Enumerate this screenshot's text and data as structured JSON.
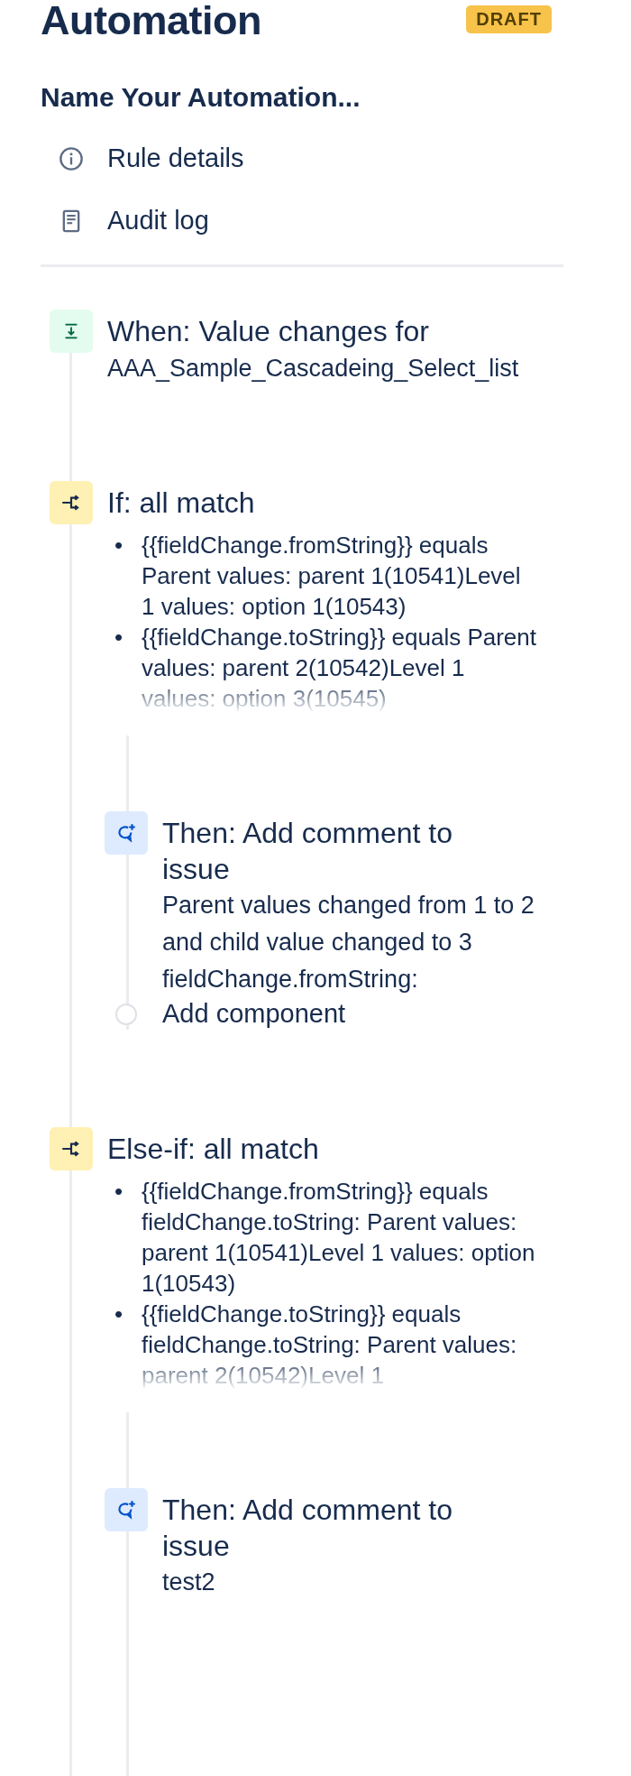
{
  "header": {
    "title": "Automation",
    "badge": "DRAFT"
  },
  "rule_name": "Name Your Automation...",
  "menu": [
    {
      "label": "Rule details"
    },
    {
      "label": "Audit log"
    }
  ],
  "steps": [
    {
      "kind": "trigger",
      "title": "When: Value changes for",
      "subtitle": "AAA_Sample_Cascadeing_Select_list"
    },
    {
      "kind": "condition",
      "title": "If: all match",
      "items": [
        {
          "marker": "•",
          "text": "{{fieldChange.fromString}} equals Parent values: parent 1(10541)Level 1 values: option 1(10543)"
        },
        {
          "marker": "•",
          "text": "{{fieldChange.toString}} equals Parent values: parent 2(10542)Level 1 values: option 3(10545)"
        }
      ],
      "children": [
        {
          "kind": "action",
          "title": "Then: Add comment to issue",
          "body": "Parent values changed from 1 to 2 and child value changed to 3 fieldChange.fromString:"
        },
        {
          "kind": "add",
          "title": "Add component"
        }
      ]
    },
    {
      "kind": "condition",
      "title": "Else-if: all match",
      "items": [
        {
          "marker": "•",
          "text": "{{fieldChange.fromString}} equals fieldChange.toString: Parent values: parent 1(10541)Level 1 values: option 1(10543)"
        },
        {
          "marker": "•",
          "text": "{{fieldChange.toString}} equals fieldChange.toString: Parent values: parent 2(10542)Level 1"
        }
      ],
      "children": [
        {
          "kind": "action",
          "title": "Then: Add comment to issue",
          "body": "test2"
        }
      ]
    }
  ]
}
